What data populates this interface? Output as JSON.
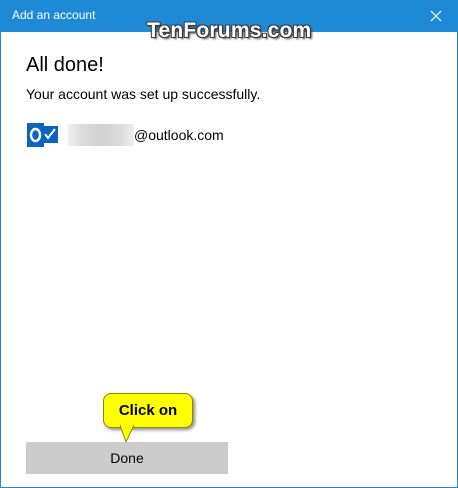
{
  "window": {
    "title": "Add an account",
    "watermark": "TenForums.com",
    "accent_color": "#1e8ad6"
  },
  "content": {
    "heading": "All done!",
    "message": "Your account was set up successfully.",
    "account": {
      "icon": "outlook-icon",
      "email_suffix": "@outlook.com"
    }
  },
  "annotation": {
    "callout_text": "Click on",
    "callout_color": "#ffff00"
  },
  "footer": {
    "done_label": "Done"
  }
}
